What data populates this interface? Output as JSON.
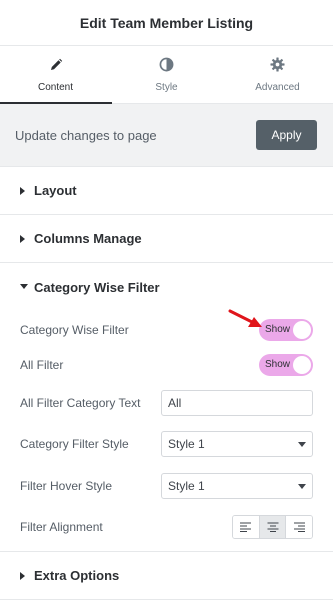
{
  "header": {
    "title": "Edit Team Member Listing"
  },
  "tabs": [
    {
      "label": "Content",
      "icon": "pencil-icon",
      "active": true
    },
    {
      "label": "Style",
      "icon": "contrast-icon",
      "active": false
    },
    {
      "label": "Advanced",
      "icon": "gear-icon",
      "active": false
    }
  ],
  "update": {
    "text": "Update changes to page",
    "button": "Apply"
  },
  "sections": {
    "layout": "Layout",
    "columns": "Columns Manage",
    "category": "Category Wise Filter",
    "extra": "Extra Options"
  },
  "controls": {
    "category_filter": {
      "label": "Category Wise Filter",
      "toggle": "Show"
    },
    "all_filter": {
      "label": "All Filter",
      "toggle": "Show"
    },
    "all_filter_text": {
      "label": "All Filter Category Text",
      "value": "All"
    },
    "category_style": {
      "label": "Category Filter Style",
      "value": "Style 1"
    },
    "hover_style": {
      "label": "Filter Hover Style",
      "value": "Style 1"
    },
    "alignment": {
      "label": "Filter Alignment",
      "selected": "center"
    }
  },
  "colors": {
    "toggle_on": "#eba8e9",
    "apply_bg": "#556068",
    "annotation_arrow": "#e0151b"
  }
}
